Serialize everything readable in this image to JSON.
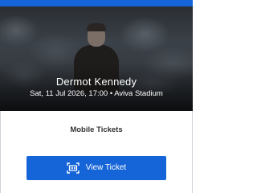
{
  "event": {
    "artist": "Dermot Kennedy",
    "details": "Sat, 11 Jul 2026, 17:00 • Aviva Stadium"
  },
  "tickets": {
    "section_title": "Mobile Tickets",
    "view_button_label": "View Ticket",
    "view_button_icon": "ticket-scan-icon"
  },
  "colors": {
    "accent": "#1565d8",
    "text_dark": "#333333"
  }
}
